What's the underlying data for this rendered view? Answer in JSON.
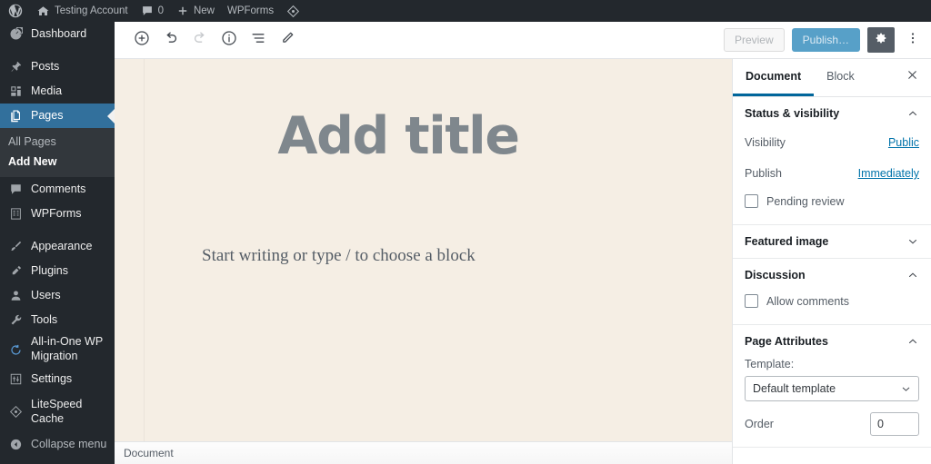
{
  "adminbar": {
    "logo_icon": "wordpress-logo-icon",
    "site_name": "Testing Account",
    "site_icon": "home-icon",
    "comments_icon": "comment-bubble-icon",
    "comments_count": "0",
    "new_icon": "plus-icon",
    "new_label": "New",
    "wpforms_label": "WPForms",
    "litespeed_icon": "litespeed-diamond-icon"
  },
  "sidebar": {
    "items": [
      {
        "label": "Dashboard",
        "icon": "dashboard-icon",
        "current": false
      },
      {
        "label": "Posts",
        "icon": "pin-icon",
        "current": false
      },
      {
        "label": "Media",
        "icon": "media-icon",
        "current": false
      },
      {
        "label": "Pages",
        "icon": "pages-icon",
        "current": true
      },
      {
        "label": "Comments",
        "icon": "comment-bubble-icon",
        "current": false
      },
      {
        "label": "WPForms",
        "icon": "wpforms-icon",
        "current": false
      },
      {
        "label": "Appearance",
        "icon": "paintbrush-icon",
        "current": false
      },
      {
        "label": "Plugins",
        "icon": "plug-icon",
        "current": false
      },
      {
        "label": "Users",
        "icon": "user-icon",
        "current": false
      },
      {
        "label": "Tools",
        "icon": "wrench-icon",
        "current": false
      },
      {
        "label": "All-in-One WP Migration",
        "icon": "migration-icon",
        "current": false
      },
      {
        "label": "Settings",
        "icon": "settings-sliders-icon",
        "current": false
      },
      {
        "label": "LiteSpeed Cache",
        "icon": "litespeed-diamond-icon",
        "current": false
      }
    ],
    "submenu": [
      {
        "label": "All Pages",
        "current": false
      },
      {
        "label": "Add New",
        "current": true
      }
    ],
    "collapse": {
      "label": "Collapse menu",
      "icon": "collapse-arrow-icon"
    }
  },
  "toolbar": {
    "add_block_icon": "plus-circle-icon",
    "undo_icon": "undo-arrow-icon",
    "redo_icon": "redo-arrow-icon",
    "info_icon": "info-circle-icon",
    "list_view_icon": "list-view-icon",
    "edit_icon": "pencil-icon",
    "preview_label": "Preview",
    "publish_label": "Publish…",
    "settings_icon": "gear-icon",
    "more_icon": "kebab-menu-icon"
  },
  "canvas": {
    "title_placeholder": "Add title",
    "block_placeholder": "Start writing or type / to choose a block",
    "background": "#f5eee4"
  },
  "statusbar": {
    "breadcrumb": "Document"
  },
  "settings": {
    "tabs": [
      {
        "label": "Document",
        "active": true
      },
      {
        "label": "Block",
        "active": false
      }
    ],
    "close_icon": "close-icon",
    "sections": [
      {
        "title": "Status & visibility",
        "chevron": "chevron-up-icon",
        "rows": [
          {
            "label": "Visibility",
            "value": "Public"
          },
          {
            "label": "Publish",
            "value": "Immediately"
          }
        ],
        "checkbox": {
          "label": "Pending review",
          "checked": false
        }
      },
      {
        "title": "Featured image",
        "chevron": "chevron-down-icon"
      },
      {
        "title": "Discussion",
        "chevron": "chevron-up-icon",
        "checkbox": {
          "label": "Allow comments",
          "checked": false
        }
      },
      {
        "title": "Page Attributes",
        "chevron": "chevron-up-icon",
        "template_label": "Template:",
        "template_value": "Default template",
        "order_label": "Order",
        "order_value": "0"
      }
    ]
  },
  "colors": {
    "admin_dark": "#23282d",
    "admin_submenu": "#32373c",
    "accent_blue": "#32709c",
    "link_blue": "#0073aa",
    "publish_blue": "#57a0c8",
    "canvas_cream": "#f5eee4"
  }
}
